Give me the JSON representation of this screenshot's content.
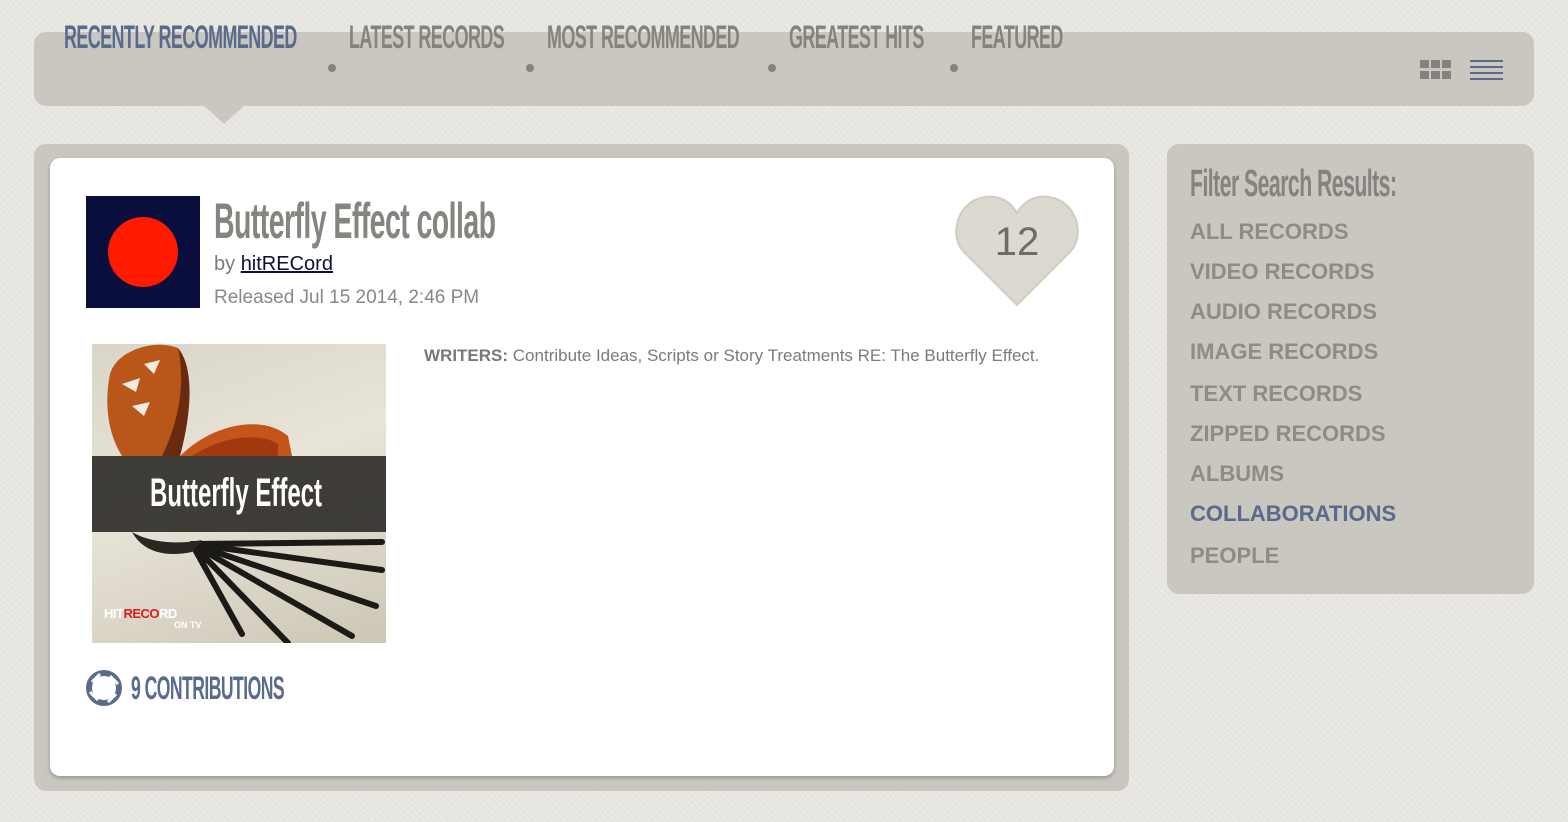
{
  "nav": {
    "tabs": [
      {
        "label": "RECENTLY RECOMMENDED",
        "active": true
      },
      {
        "label": "LATEST RECORDS",
        "active": false
      },
      {
        "label": "MOST RECOMMENDED",
        "active": false
      },
      {
        "label": "GREATEST HITS",
        "active": false
      },
      {
        "label": "FEATURED",
        "active": false
      }
    ],
    "view_modes": {
      "grid_icon": "grid-view-icon",
      "list_icon": "list-view-icon",
      "selected": "list"
    }
  },
  "record": {
    "title": "Butterfly Effect collab",
    "by_prefix": "by",
    "author": "hitRECord",
    "released": "Released Jul 15 2014, 2:46 PM",
    "heart_count": "12",
    "thumbnail": {
      "banner_text": "Butterfly Effect",
      "logo_hit": "HIT",
      "logo_reco": "RECO",
      "logo_rd": "RD",
      "logo_sub": "ON TV"
    },
    "description_label": "WRITERS:",
    "description_text": "Contribute Ideas, Scripts or Story Treatments RE: The Butterfly Effect.",
    "contributions": "9 CONTRIBUTIONS"
  },
  "filter": {
    "title": "Filter Search Results:",
    "items": [
      {
        "label": "ALL RECORDS",
        "active": false
      },
      {
        "label": "VIDEO RECORDS",
        "active": false
      },
      {
        "label": "AUDIO RECORDS",
        "active": false
      },
      {
        "label": "IMAGE RECORDS",
        "active": false
      },
      {
        "label": "TEXT RECORDS",
        "active": false
      },
      {
        "label": "ZIPPED RECORDS",
        "active": false
      },
      {
        "label": "ALBUMS",
        "active": false
      },
      {
        "label": "COLLABORATIONS",
        "active": true
      },
      {
        "label": "PEOPLE",
        "active": false
      }
    ]
  },
  "colors": {
    "accent": "#5a6a8c",
    "muted": "#85837d",
    "panel": "#c9c7c0",
    "avatar_bg": "#0a0e3c",
    "avatar_dot": "#ff1a00"
  }
}
